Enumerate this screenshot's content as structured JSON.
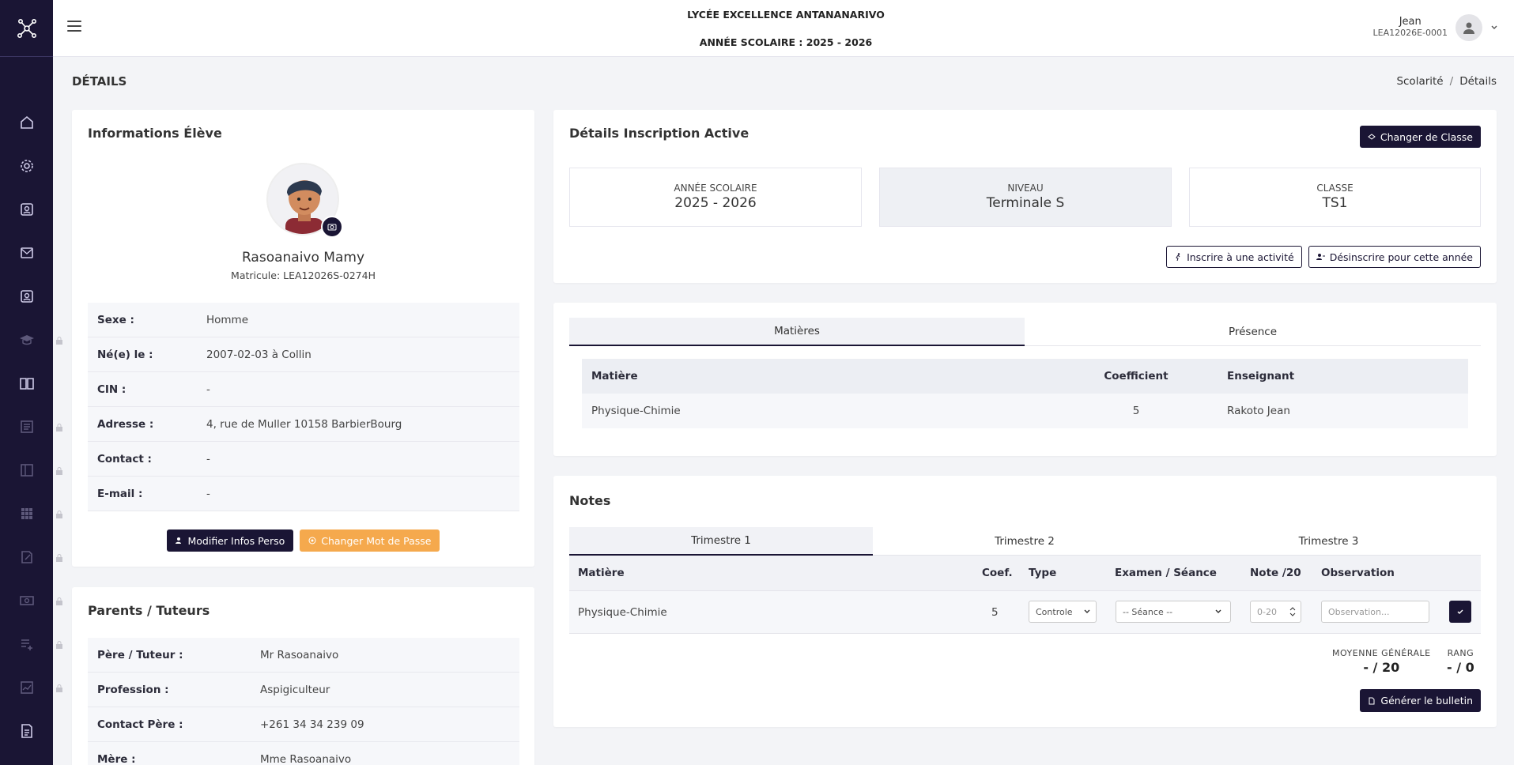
{
  "topbar": {
    "school_name": "LYCÉE EXCELLENCE ANTANANARIVO",
    "school_year": "ANNÉE SCOLAIRE : 2025 - 2026",
    "user_name": "Jean",
    "user_id": "LEA12026E-0001"
  },
  "page": {
    "title": "DÉTAILS",
    "breadcrumb": [
      "Scolarité",
      "/",
      "Détails"
    ]
  },
  "student_card": {
    "title": "Informations Élève",
    "name": "Rasoanaivo Mamy",
    "matricule": "Matricule: LEA12026S-0274H",
    "rows": [
      {
        "label": "Sexe :",
        "value": "Homme"
      },
      {
        "label": "Né(e) le :",
        "value": "2007-02-03 à Collin"
      },
      {
        "label": "CIN :",
        "value": "-"
      },
      {
        "label": "Adresse :",
        "value": "4, rue de Muller 10158 BarbierBourg"
      },
      {
        "label": "Contact :",
        "value": "-"
      },
      {
        "label": "E-mail :",
        "value": "-"
      }
    ],
    "edit_button": "Modifier Infos Perso",
    "password_button": "Changer Mot de Passe"
  },
  "parents_card": {
    "title": "Parents / Tuteurs",
    "rows": [
      {
        "label": "Père / Tuteur :",
        "value": "Mr Rasoanaivo"
      },
      {
        "label": "Profession :",
        "value": "Aspigiculteur"
      },
      {
        "label": "Contact Père :",
        "value": "+261 34 34 239 09"
      },
      {
        "label": "Mère :",
        "value": "Mme Rasoanaivo"
      }
    ]
  },
  "inscription_card": {
    "title": "Détails Inscription Active",
    "change_class_button": "Changer de Classe",
    "stats": [
      {
        "label": "ANNÉE SCOLAIRE",
        "value": "2025 - 2026"
      },
      {
        "label": "NIVEAU",
        "value": "Terminale S"
      },
      {
        "label": "CLASSE",
        "value": "TS1"
      }
    ],
    "activity_button": "Inscrire à une activité",
    "unregister_button": "Désinscrire pour cette année"
  },
  "subjects_card": {
    "tabs": [
      "Matières",
      "Présence"
    ],
    "headers": [
      "Matière",
      "Coefficient",
      "Enseignant"
    ],
    "rows": [
      {
        "subject": "Physique-Chimie",
        "coef": "5",
        "teacher": "Rakoto Jean"
      }
    ]
  },
  "notes_card": {
    "title": "Notes",
    "tabs": [
      "Trimestre 1",
      "Trimestre 2",
      "Trimestre 3"
    ],
    "headers": [
      "Matière",
      "Coef.",
      "Type",
      "Examen / Séance",
      "Note /20",
      "Observation"
    ],
    "row": {
      "subject": "Physique-Chimie",
      "coef": "5",
      "type": "Controle",
      "exam": "-- Séance --",
      "note_placeholder": "0-20",
      "obs_placeholder": "Observation..."
    },
    "average_label": "MOYENNE GÉNÉRALE",
    "average_value": "- / 20",
    "rank_label": "RANG",
    "rank_value": "- / 0",
    "bulletin_button": "Générer le bulletin"
  },
  "colors": {
    "sidebar": "#1a1534",
    "accent_dark": "#1a1534",
    "accent_orange": "#f5a94d"
  }
}
